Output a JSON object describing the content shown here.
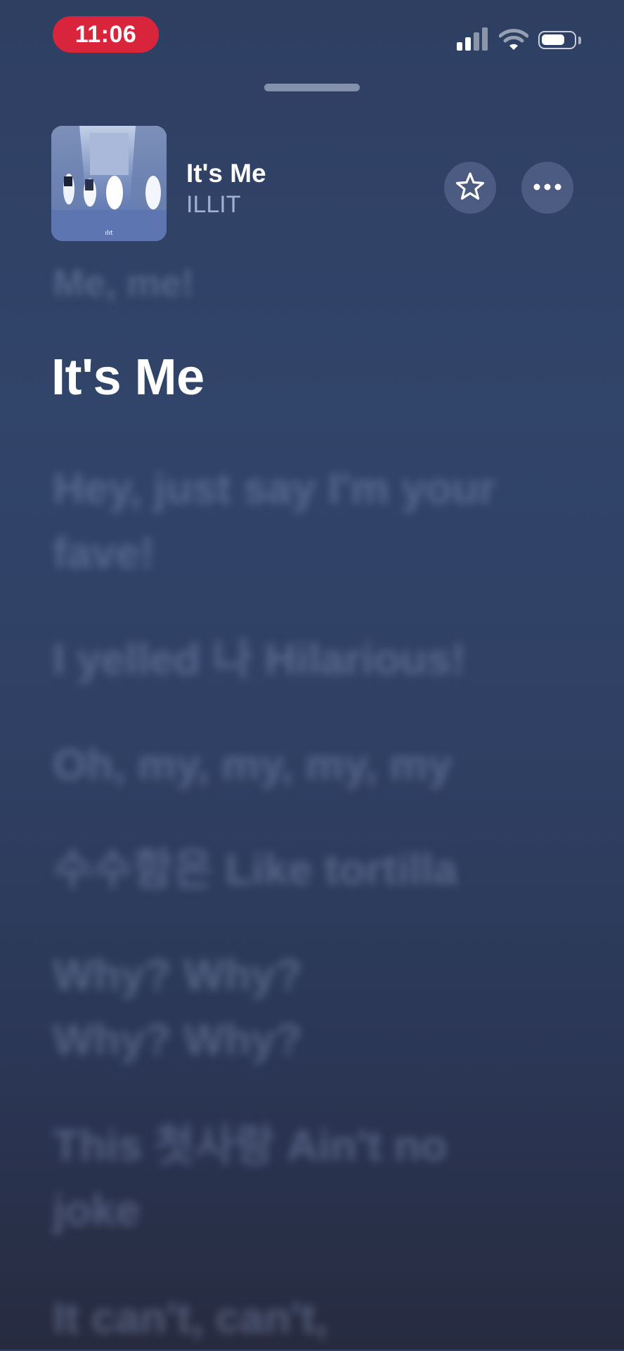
{
  "status_bar": {
    "time": "11:06",
    "signal_icon": "cellular-signal-icon",
    "wifi_icon": "wifi-icon",
    "battery_icon": "battery-icon"
  },
  "now_playing": {
    "artwork_icon": "album-artwork",
    "title": "It's Me",
    "artist": "ILLIT",
    "favorite_icon": "star-icon",
    "more_icon": "ellipsis-icon"
  },
  "lyrics": {
    "previous_line": "Me, me!",
    "current_line": "It's Me",
    "upcoming": [
      "Hey, just say I'm your fave!",
      "I yelled 나 Hilarious!",
      "Oh, my, my, my, my",
      "수수함은 Like tortilla",
      "Why? Why? Why? Why?",
      "This 첫사랑 Ain't no joke",
      "It can't, can't,"
    ]
  },
  "colors": {
    "time_pill": "#d9253c",
    "background_top": "#2e3f62",
    "background_bottom": "#262b40"
  }
}
